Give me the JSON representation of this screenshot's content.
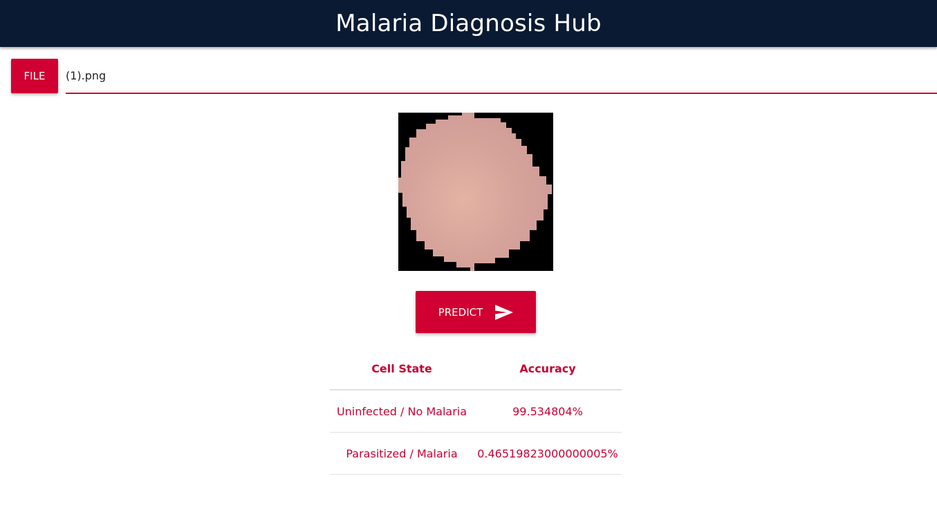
{
  "header": {
    "title": "Malaria Diagnosis Hub"
  },
  "file_input": {
    "button_label": "FILE",
    "file_name": "(1).png"
  },
  "preview": {
    "image_description_icon": "blood-cell-image"
  },
  "predict": {
    "label": "PREDICT",
    "icon": "send-icon"
  },
  "results": {
    "headers": [
      "Cell State",
      "Accuracy"
    ],
    "rows": [
      [
        "Uninfected / No Malaria",
        "99.534804%"
      ],
      [
        "Parasitized / Malaria",
        "0.46519823000000005%"
      ]
    ]
  },
  "colors": {
    "appbar": "#0b1a33",
    "accent": "#d00032",
    "text_accent": "#c80032"
  }
}
